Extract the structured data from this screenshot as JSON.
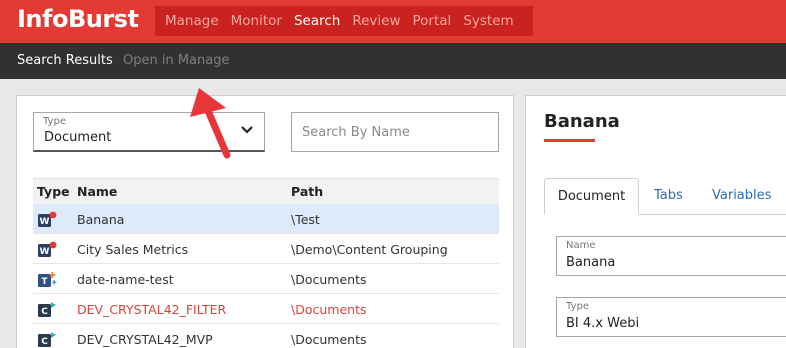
{
  "app": {
    "title": "InfoBurst"
  },
  "nav": [
    {
      "label": "Manage",
      "active": false
    },
    {
      "label": "Monitor",
      "active": false
    },
    {
      "label": "Search",
      "active": true
    },
    {
      "label": "Review",
      "active": false
    },
    {
      "label": "Portal",
      "active": false
    },
    {
      "label": "System",
      "active": false
    }
  ],
  "subnav": {
    "results": "Search Results",
    "open_in_manage": "Open in Manage"
  },
  "filter": {
    "type_label": "Type",
    "type_value": "Document",
    "search_placeholder": "Search By Name"
  },
  "table": {
    "headers": {
      "type": "Type",
      "name": "Name",
      "path": "Path"
    },
    "rows": [
      {
        "icon": "webi-icon",
        "name": "Banana",
        "path": "\\Test",
        "selected": true,
        "error": false
      },
      {
        "icon": "webi-icon",
        "name": "City Sales Metrics",
        "path": "\\Demo\\Content Grouping",
        "selected": false,
        "error": false
      },
      {
        "icon": "tableau-icon",
        "name": "date-name-test",
        "path": "\\Documents",
        "selected": false,
        "error": false
      },
      {
        "icon": "crystal-icon",
        "name": "DEV_CRYSTAL42_FILTER",
        "path": "\\Documents",
        "selected": false,
        "error": true
      },
      {
        "icon": "crystal-icon",
        "name": "DEV_CRYSTAL42_MVP",
        "path": "\\Documents",
        "selected": false,
        "error": false
      }
    ]
  },
  "detail": {
    "title": "Banana",
    "tabs": [
      "Document",
      "Tabs",
      "Variables"
    ],
    "fields": {
      "name_label": "Name",
      "name_value": "Banana",
      "type_label": "Type",
      "type_value": "BI 4.x Webi"
    }
  },
  "colors": {
    "brand_red": "#e33a33",
    "nav_dark_red": "#c9221f",
    "subbar": "#313131",
    "selected_row": "#dceafa",
    "error_text": "#d9443c",
    "link_blue": "#2b6eb4"
  }
}
